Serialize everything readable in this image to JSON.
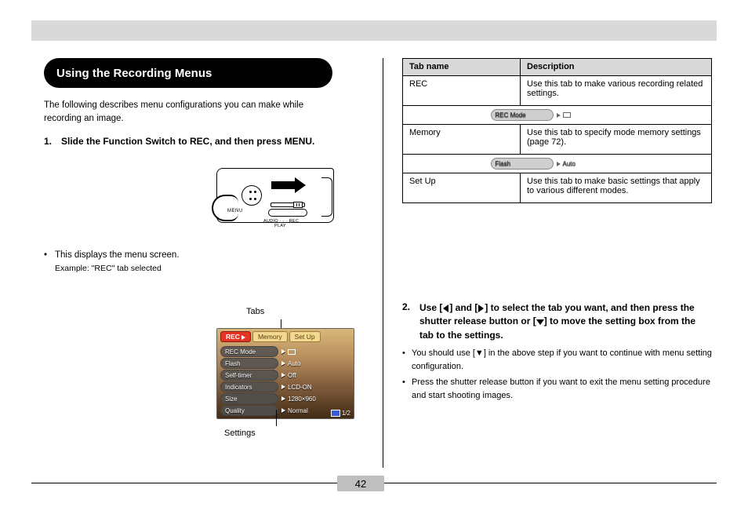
{
  "page_number": "42",
  "header_band": "",
  "left": {
    "section_title": "Using the Recording Menus",
    "intro": "The following describes menu configurations you can make while recording an image.",
    "step1_num": "1.",
    "step1_text": "Slide the Function Switch to REC, and then press MENU.",
    "bullet_text": "This displays the menu screen.",
    "example_label": "Example: \"REC\" tab selected",
    "camera_labels": {
      "menu": "MENU",
      "audio": "AUDIO",
      "rec": "REC",
      "play": "PLAY"
    },
    "callout_tabs": "Tabs",
    "callout_settings": "Settings",
    "menu_screenshot": {
      "tabs": [
        {
          "label": "REC",
          "active": true
        },
        {
          "label": "Memory",
          "active": false
        },
        {
          "label": "Set Up",
          "active": false
        }
      ],
      "rows": [
        {
          "name": "REC Mode",
          "value_icon": "single-shot-icon",
          "value_text": ""
        },
        {
          "name": "Flash",
          "value_text": "Auto"
        },
        {
          "name": "Self-timer",
          "value_text": "Off"
        },
        {
          "name": "Indicators",
          "value_text": "LCD-ON"
        },
        {
          "name": "Size",
          "value_text": "1280×960"
        },
        {
          "name": "Quality",
          "value_text": "Normal"
        }
      ],
      "page_indicator": "1/2"
    }
  },
  "right": {
    "table": {
      "head_tab": "Tab name",
      "head_desc": "Description",
      "rows": [
        {
          "tab": "REC",
          "desc": "Use this tab to make various recording related settings."
        },
        {
          "tab": "Memory",
          "desc": "Use this tab to specify mode memory settings (page 72)."
        },
        {
          "tab": "Set Up",
          "desc": "Use this tab to make basic settings that apply to various different modes."
        }
      ]
    },
    "step2_num": "2.",
    "step2_text_a": "Use [",
    "step2_text_b": "] and [",
    "step2_text_c": "] to select the tab you want, and then press the shutter release button or [",
    "step2_text_d": "] to move the setting box from the tab to the settings.",
    "left_key": "◀",
    "right_key": "▶",
    "down_key": "▼",
    "note1": "You should use [▼] in the above step if you want to continue with menu setting configuration.",
    "note2": "Press the shutter release button if you want to exit the menu setting procedure and start shooting images."
  }
}
